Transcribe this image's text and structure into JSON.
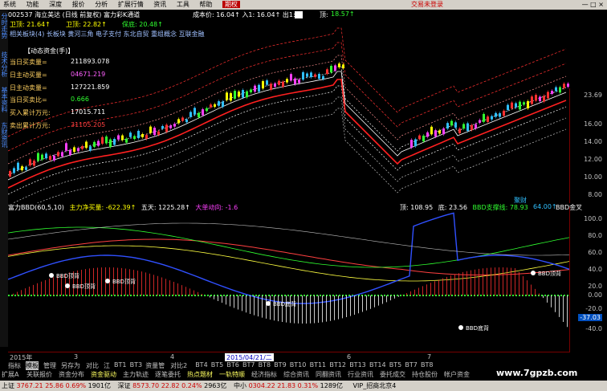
{
  "menu": {
    "items": [
      "系统",
      "功能",
      "深度",
      "报价",
      "分析",
      "扩展行情",
      "资讯",
      "工具",
      "帮助"
    ],
    "active_item": "期权",
    "phone": "交易未登录",
    "hotline": "—  □  ×"
  },
  "sidetabs": [
    "分时走势",
    "技术分析",
    "基本资料",
    "东财资讯"
  ],
  "header": {
    "code_line": "002537 海立美达 (日线 前复权) 富力彩K通道",
    "cost_line": "成本价: 16.04↑  入1: 16.04↑  出1: -",
    "wind_label": "顶:",
    "wind_value": "18.57↑",
    "row2_a": "卫顶: 21.64↑",
    "row2_b": "卫顶: 22.82↑",
    "row2_c": "保底: 20.48↑"
  },
  "concepts": "相关板块(4)  长板块   黄河三角  电子支付  东北自贸  重组概念  互联金融",
  "panel": {
    "title": "【动态资金(手)】",
    "rows": [
      {
        "label": "当日买卖量=",
        "value": "211893.078"
      },
      {
        "label": "日主动买量=",
        "value": "04671.219"
      },
      {
        "label": "日主动卖量=",
        "value": "127221.859"
      },
      {
        "label": "当日买卖比=",
        "value": "0.666"
      },
      {
        "label": "买入累计万元:",
        "value": "17015.711"
      },
      {
        "label": "卖出累计万元:",
        "value": "31105.205"
      }
    ]
  },
  "y_main": [
    "23.69",
    "16.00",
    "14.00",
    "12.00",
    "10.00",
    "8.00"
  ],
  "ind_header": {
    "name": "富力BBD(60,5,10)",
    "a": "主力净买量: -622.39↑",
    "b": "五天: 1225.28↑",
    "c": "大单动向: -1.6",
    "d": "顶: 108.95",
    "e": "底: 23.56",
    "f": "BBD支撑线: 78.93",
    "g": "64.00↑",
    "h": "BBD金叉",
    "link": "聚财"
  },
  "y_ind": [
    "100.0",
    "80.0",
    "60.0",
    "40.0",
    "20.0",
    "0.00",
    "-20.0",
    "-37.03",
    "-40.0"
  ],
  "x_axis": [
    "2015年",
    "3",
    "4",
    "2015/04/21/二",
    "6",
    "7"
  ],
  "bottom_tabs": [
    "指标",
    "模板",
    "管理",
    "另存为",
    "对比",
    "江",
    "BT1",
    "BT3",
    "资量管",
    "对比2",
    "BT4",
    "BT5",
    "BT6",
    "BT7",
    "BT8",
    "BT9",
    "BT10",
    "BT11",
    "BT12",
    "BT13",
    "BT14",
    "BT5",
    "BT7",
    "BT8"
  ],
  "func_bar": [
    "扩展A",
    "关联报价",
    "资金分布",
    "资金驱动",
    "主力轨迹",
    "逐笔委托",
    "热点题材",
    "一轨特顺",
    "经济指标",
    "综合资讯",
    "同翻资讯",
    "行业资讯",
    "委托成交",
    "持仓股份",
    "帐户资金"
  ],
  "status": {
    "sh_label": "上证",
    "sh": "3767.21",
    "sh_chg": "25.86",
    "sh_pct": "0.69%",
    "sh_amt": "1901亿",
    "sz_label": "深证",
    "sz": "8573.70",
    "sz_chg": "22.82",
    "sz_pct": "0.24%",
    "sz_amt": "2963亿",
    "sm_label": "中小",
    "sm": "0304.22",
    "sm_chg": "21.83",
    "sm_pct": "0.31%",
    "sm_amt": "1289亿",
    "vip": "VIP_招商北京4"
  },
  "labels": {
    "bbd_top": "BBD顶背",
    "bbd_bottom": "BBD底背"
  },
  "watermark": "www.7gpzb.com",
  "colors": {
    "up": "#ff3030",
    "down": "#30c0ff",
    "bg": "#000000",
    "axis": "#700000",
    "magenta": "#ff40ff",
    "green": "#20ff20",
    "yellow": "#ffff00"
  }
}
